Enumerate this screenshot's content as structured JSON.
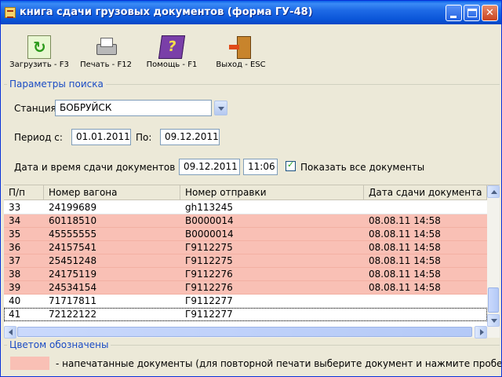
{
  "window": {
    "title": "книга сдачи грузовых документов (форма ГУ-48)"
  },
  "toolbar": {
    "load_label": "Загрузить - F3",
    "print_label": "Печать - F12",
    "help_label": "Помощь - F1",
    "exit_label": "Выход - ESC"
  },
  "search": {
    "group_title": "Параметры поиска",
    "station_label": "Станция",
    "station_value": "БОБРУЙСК",
    "period_label": "Период с:",
    "period_from": "01.01.2011",
    "period_to_label": "По:",
    "period_to": "09.12.2011",
    "datetime_label": "Дата и время сдачи документов :",
    "date_value": "09.12.2011",
    "time_value": "11:06",
    "show_all_label": "Показать все документы",
    "show_all_checked": true
  },
  "grid": {
    "columns": [
      "П/п",
      "Номер вагона",
      "Номер отправки",
      "Дата сдачи документа"
    ],
    "rows": [
      {
        "n": "33",
        "wagon": "24199689",
        "shipment": "gh113245",
        "date": "",
        "printed": false
      },
      {
        "n": "34",
        "wagon": "60118510",
        "shipment": "В0000014",
        "date": "08.08.11 14:58",
        "printed": true
      },
      {
        "n": "35",
        "wagon": "45555555",
        "shipment": "В0000014",
        "date": "08.08.11 14:58",
        "printed": true
      },
      {
        "n": "36",
        "wagon": "24157541",
        "shipment": "Г9112275",
        "date": "08.08.11 14:58",
        "printed": true
      },
      {
        "n": "37",
        "wagon": "25451248",
        "shipment": "Г9112275",
        "date": "08.08.11 14:58",
        "printed": true
      },
      {
        "n": "38",
        "wagon": "24175119",
        "shipment": "Г9112276",
        "date": "08.08.11 14:58",
        "printed": true
      },
      {
        "n": "39",
        "wagon": "24534154",
        "shipment": "Г9112276",
        "date": "08.08.11 14:58",
        "printed": true
      },
      {
        "n": "40",
        "wagon": "71717811",
        "shipment": "Г9112277",
        "date": "",
        "printed": false
      },
      {
        "n": "41",
        "wagon": "72122122",
        "shipment": "Г9112277",
        "date": "",
        "printed": false
      }
    ],
    "selected_row": "41"
  },
  "legend": {
    "group_title": "Цветом обозначены",
    "printed_color": "#f9c0b5",
    "printed_text": "- напечатанные документы (для повторной печати выберите документ и нажмите пробел)"
  },
  "colors": {
    "titlebar": "#0a55d8",
    "accent": "#1a4bc4",
    "printed_row": "#f9c0b5"
  }
}
